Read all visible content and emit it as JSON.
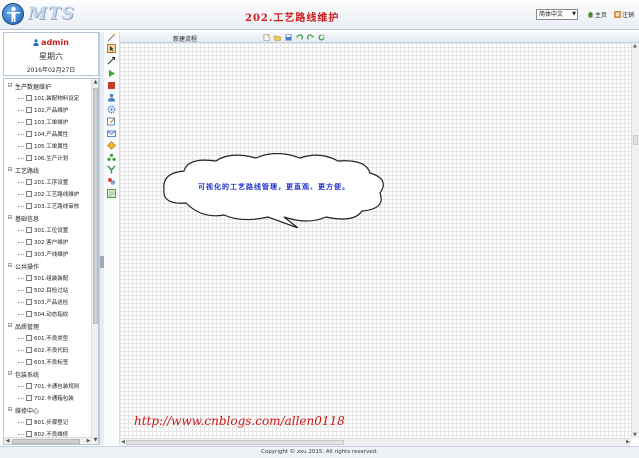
{
  "app": {
    "logo_text": "MTS",
    "page_title": "202.工艺路线维护",
    "language_select": {
      "value": "简体中文"
    },
    "header_links": {
      "home": "主页",
      "logout": "注销"
    }
  },
  "user": {
    "name": "admin",
    "weekday": "星期六",
    "date": "2016年02月27日"
  },
  "nav_tree": {
    "groups": [
      {
        "label": "生产数据维护",
        "items": [
          "101.装配物料设定",
          "102.产品维护",
          "103.工单维护",
          "104.产品属性",
          "105.工单属性",
          "106.生产计划"
        ]
      },
      {
        "label": "工艺路线",
        "items": [
          "201.工序设置",
          "202.工艺路线维护",
          "203.工艺路线审核"
        ]
      },
      {
        "label": "基础信息",
        "items": [
          "301.工位设置",
          "302.客户维护",
          "303.产线维护"
        ]
      },
      {
        "label": "公共操作",
        "items": [
          "501.组装装配",
          "502.目检过站",
          "503.产品送检",
          "504.动态指纹"
        ]
      },
      {
        "label": "品质管理",
        "items": [
          "601.不良类型",
          "602.不良代码",
          "603.不良标签"
        ]
      },
      {
        "label": "包装系统",
        "items": [
          "701.卡通包装规则",
          "702.卡通箱包装"
        ]
      },
      {
        "label": "维修中心",
        "items": [
          "801.步骤登记",
          "802.不良维修"
        ]
      }
    ]
  },
  "workspace": {
    "flow_name": "新建流程",
    "note_text": "可视化的工艺路线管理，更直观、更方便。"
  },
  "watermark": "http://www.cnblogs.com/allen0118",
  "footer": {
    "copyright": "Copyright © zxu 2015. All rights reserved."
  }
}
